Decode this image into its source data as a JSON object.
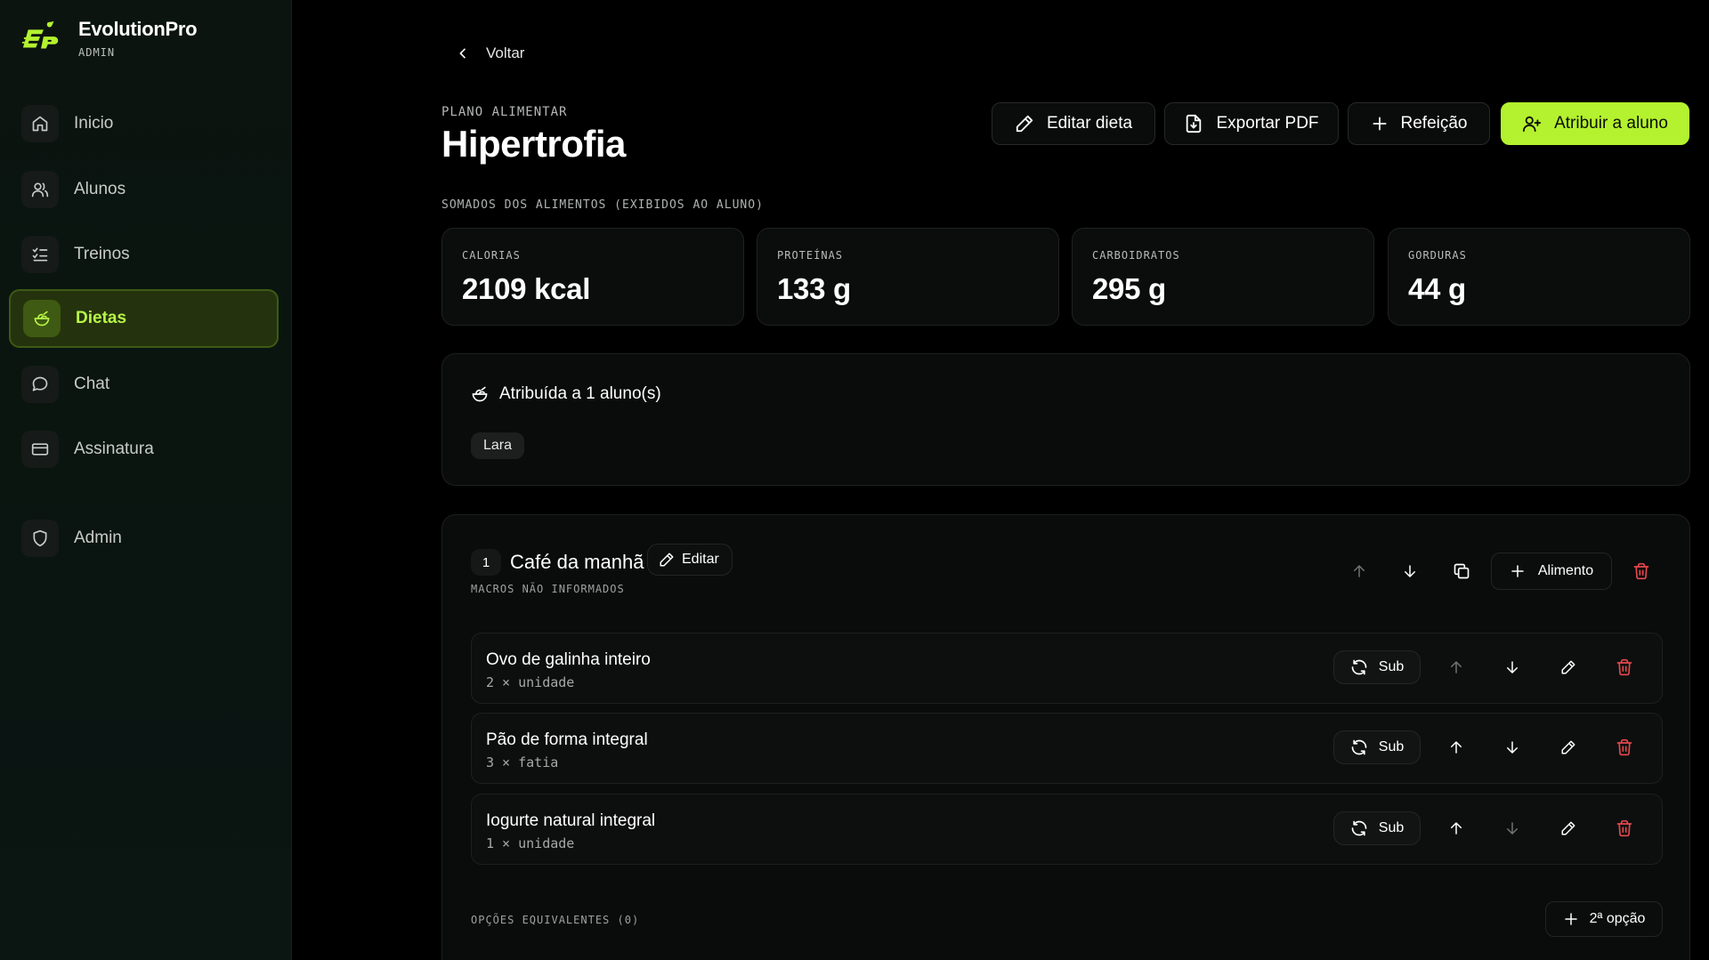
{
  "brand": {
    "name": "EvolutionPro",
    "role": "ADMIN"
  },
  "nav": [
    {
      "label": "Inicio",
      "icon": "home-icon",
      "active": false
    },
    {
      "label": "Alunos",
      "icon": "users-icon",
      "active": false
    },
    {
      "label": "Treinos",
      "icon": "checklist-icon",
      "active": false
    },
    {
      "label": "Dietas",
      "icon": "salad-icon",
      "active": true
    },
    {
      "label": "Chat",
      "icon": "chat-icon",
      "active": false
    },
    {
      "label": "Assinatura",
      "icon": "credit-card-icon",
      "active": false
    },
    {
      "label": "Admin",
      "icon": "shield-icon",
      "active": false
    }
  ],
  "back_label": "Voltar",
  "header": {
    "eyebrow": "PLANO ALIMENTAR",
    "title": "Hipertrofia",
    "actions": {
      "edit": "Editar dieta",
      "export": "Exportar PDF",
      "meal": "Refeição",
      "assign": "Atribuir a aluno"
    }
  },
  "macros_label": "SOMADOS DOS ALIMENTOS (EXIBIDOS AO ALUNO)",
  "macros": [
    {
      "label": "CALORIAS",
      "value": "2109 kcal"
    },
    {
      "label": "PROTEÍNAS",
      "value": "133 g"
    },
    {
      "label": "CARBOIDRATOS",
      "value": "295 g"
    },
    {
      "label": "GORDURAS",
      "value": "44 g"
    }
  ],
  "assignment": {
    "title": "Atribuída a 1 aluno(s)",
    "students": [
      "Lara"
    ]
  },
  "meal": {
    "number": "1",
    "name": "Café da manhã",
    "edit_label": "Editar",
    "macros_note": "MACROS NÃO INFORMADOS",
    "add_food_label": "Alimento",
    "sub_label": "Sub",
    "foods": [
      {
        "name": "Ovo de galinha inteiro",
        "qty": "2 × unidade"
      },
      {
        "name": "Pão de forma integral",
        "qty": "3 × fatia"
      },
      {
        "name": "Iogurte natural integral",
        "qty": "1 × unidade"
      }
    ],
    "options_label": "OPÇÕES EQUIVALENTES (0)",
    "second_option_label": "2ª opção"
  },
  "colors": {
    "accent": "#b4f22f",
    "danger": "#e5484d",
    "background": "#000000"
  }
}
